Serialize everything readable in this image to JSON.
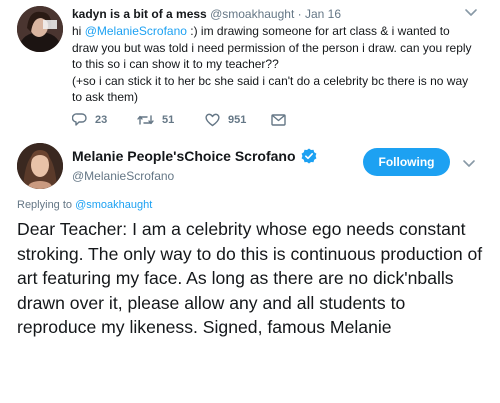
{
  "tweet1": {
    "name": "kadyn is a bit of a mess",
    "handle": "@smoakhaught",
    "separator": "·",
    "date": "Jan 16",
    "text_prefix": "hi ",
    "mention": "@MelanieScrofano",
    "text_line1_rest": " :) im drawing someone for art class & i wanted to draw you but was told i need permission of the person i draw. can you reply to this so i can show it to my teacher??",
    "text_line2": "(+so i can stick it to her bc she said i can't do a celebrity bc there is no way to ask them)",
    "actions": {
      "reply_icon": "reply-icon",
      "reply_count": "23",
      "retweet_icon": "retweet-icon",
      "retweet_count": "51",
      "like_icon": "heart-icon",
      "like_count": "951",
      "dm_icon": "envelope-icon"
    }
  },
  "tweet2": {
    "name": "Melanie People'sChoice Scrofano",
    "verified_icon": "verified-badge-icon",
    "handle": "@MelanieScrofano",
    "follow_label": "Following",
    "replying_prefix": "Replying to ",
    "replying_mention": "@smoakhaught",
    "text": "Dear Teacher: I am a celebrity whose ego needs constant stroking. The only way to do this is continuous production of art featuring my face. As long as there are no dick'nballs drawn over it, please allow any and all students to reproduce my likeness. Signed, famous Melanie"
  },
  "colors": {
    "accent": "#1da1f2",
    "secondary_text": "#657786",
    "primary_text": "#14171a"
  }
}
